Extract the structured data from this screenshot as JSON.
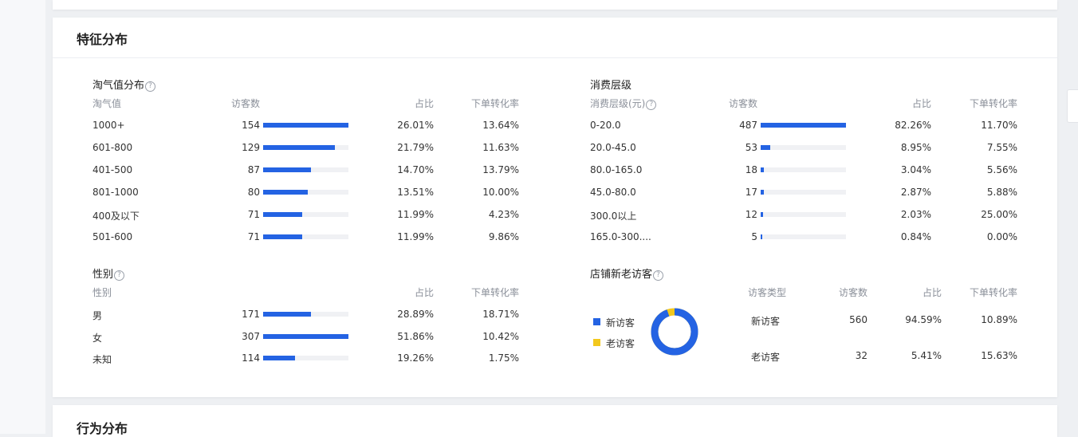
{
  "section_title": "特征分布",
  "next_section_title": "行为分布",
  "taoqi": {
    "title": "淘气值分布",
    "headers": [
      "淘气值",
      "访客数",
      "占比",
      "下单转化率"
    ],
    "rows": [
      {
        "label": "1000+",
        "visitors": "154",
        "share": "26.01%",
        "conv": "13.64%",
        "fill": 1.0
      },
      {
        "label": "601-800",
        "visitors": "129",
        "share": "21.79%",
        "conv": "11.63%",
        "fill": 0.84
      },
      {
        "label": "401-500",
        "visitors": "87",
        "share": "14.70%",
        "conv": "13.79%",
        "fill": 0.56
      },
      {
        "label": "801-1000",
        "visitors": "80",
        "share": "13.51%",
        "conv": "10.00%",
        "fill": 0.52
      },
      {
        "label": "400及以下",
        "visitors": "71",
        "share": "11.99%",
        "conv": "4.23%",
        "fill": 0.46
      },
      {
        "label": "501-600",
        "visitors": "71",
        "share": "11.99%",
        "conv": "9.86%",
        "fill": 0.46
      }
    ]
  },
  "spend": {
    "title": "消费层级",
    "headers": [
      "消费层级(元)",
      "访客数",
      "占比",
      "下单转化率"
    ],
    "rows": [
      {
        "label": "0-20.0",
        "visitors": "487",
        "share": "82.26%",
        "conv": "11.70%",
        "fill": 1.0
      },
      {
        "label": "20.0-45.0",
        "visitors": "53",
        "share": "8.95%",
        "conv": "7.55%",
        "fill": 0.11
      },
      {
        "label": "80.0-165.0",
        "visitors": "18",
        "share": "3.04%",
        "conv": "5.56%",
        "fill": 0.04
      },
      {
        "label": "45.0-80.0",
        "visitors": "17",
        "share": "2.87%",
        "conv": "5.88%",
        "fill": 0.04
      },
      {
        "label": "300.0以上",
        "visitors": "12",
        "share": "2.03%",
        "conv": "25.00%",
        "fill": 0.03
      },
      {
        "label": "165.0-300....",
        "visitors": "5",
        "share": "0.84%",
        "conv": "0.00%",
        "fill": 0.01
      }
    ]
  },
  "gender": {
    "title": "性别",
    "headers": [
      "性别",
      "占比",
      "下单转化率"
    ],
    "rows": [
      {
        "label": "男",
        "visitors": "171",
        "share": "28.89%",
        "conv": "18.71%",
        "fill": 0.56
      },
      {
        "label": "女",
        "visitors": "307",
        "share": "51.86%",
        "conv": "10.42%",
        "fill": 1.0
      },
      {
        "label": "未知",
        "visitors": "114",
        "share": "19.26%",
        "conv": "1.75%",
        "fill": 0.37
      }
    ]
  },
  "newold": {
    "title": "店铺新老访客",
    "legend": [
      "新访客",
      "老访客"
    ],
    "colors": {
      "new": "#2463e3",
      "old": "#f2c81d"
    },
    "headers": [
      "访客类型",
      "访客数",
      "占比",
      "下单转化率"
    ],
    "rows": [
      {
        "label": "新访客",
        "visitors": "560",
        "share": "94.59%",
        "conv": "10.89%"
      },
      {
        "label": "老访客",
        "visitors": "32",
        "share": "5.41%",
        "conv": "15.63%"
      }
    ],
    "new_fraction": 0.9459
  },
  "icons": {
    "help": "help-circle-icon"
  },
  "help_glyph": "?"
}
